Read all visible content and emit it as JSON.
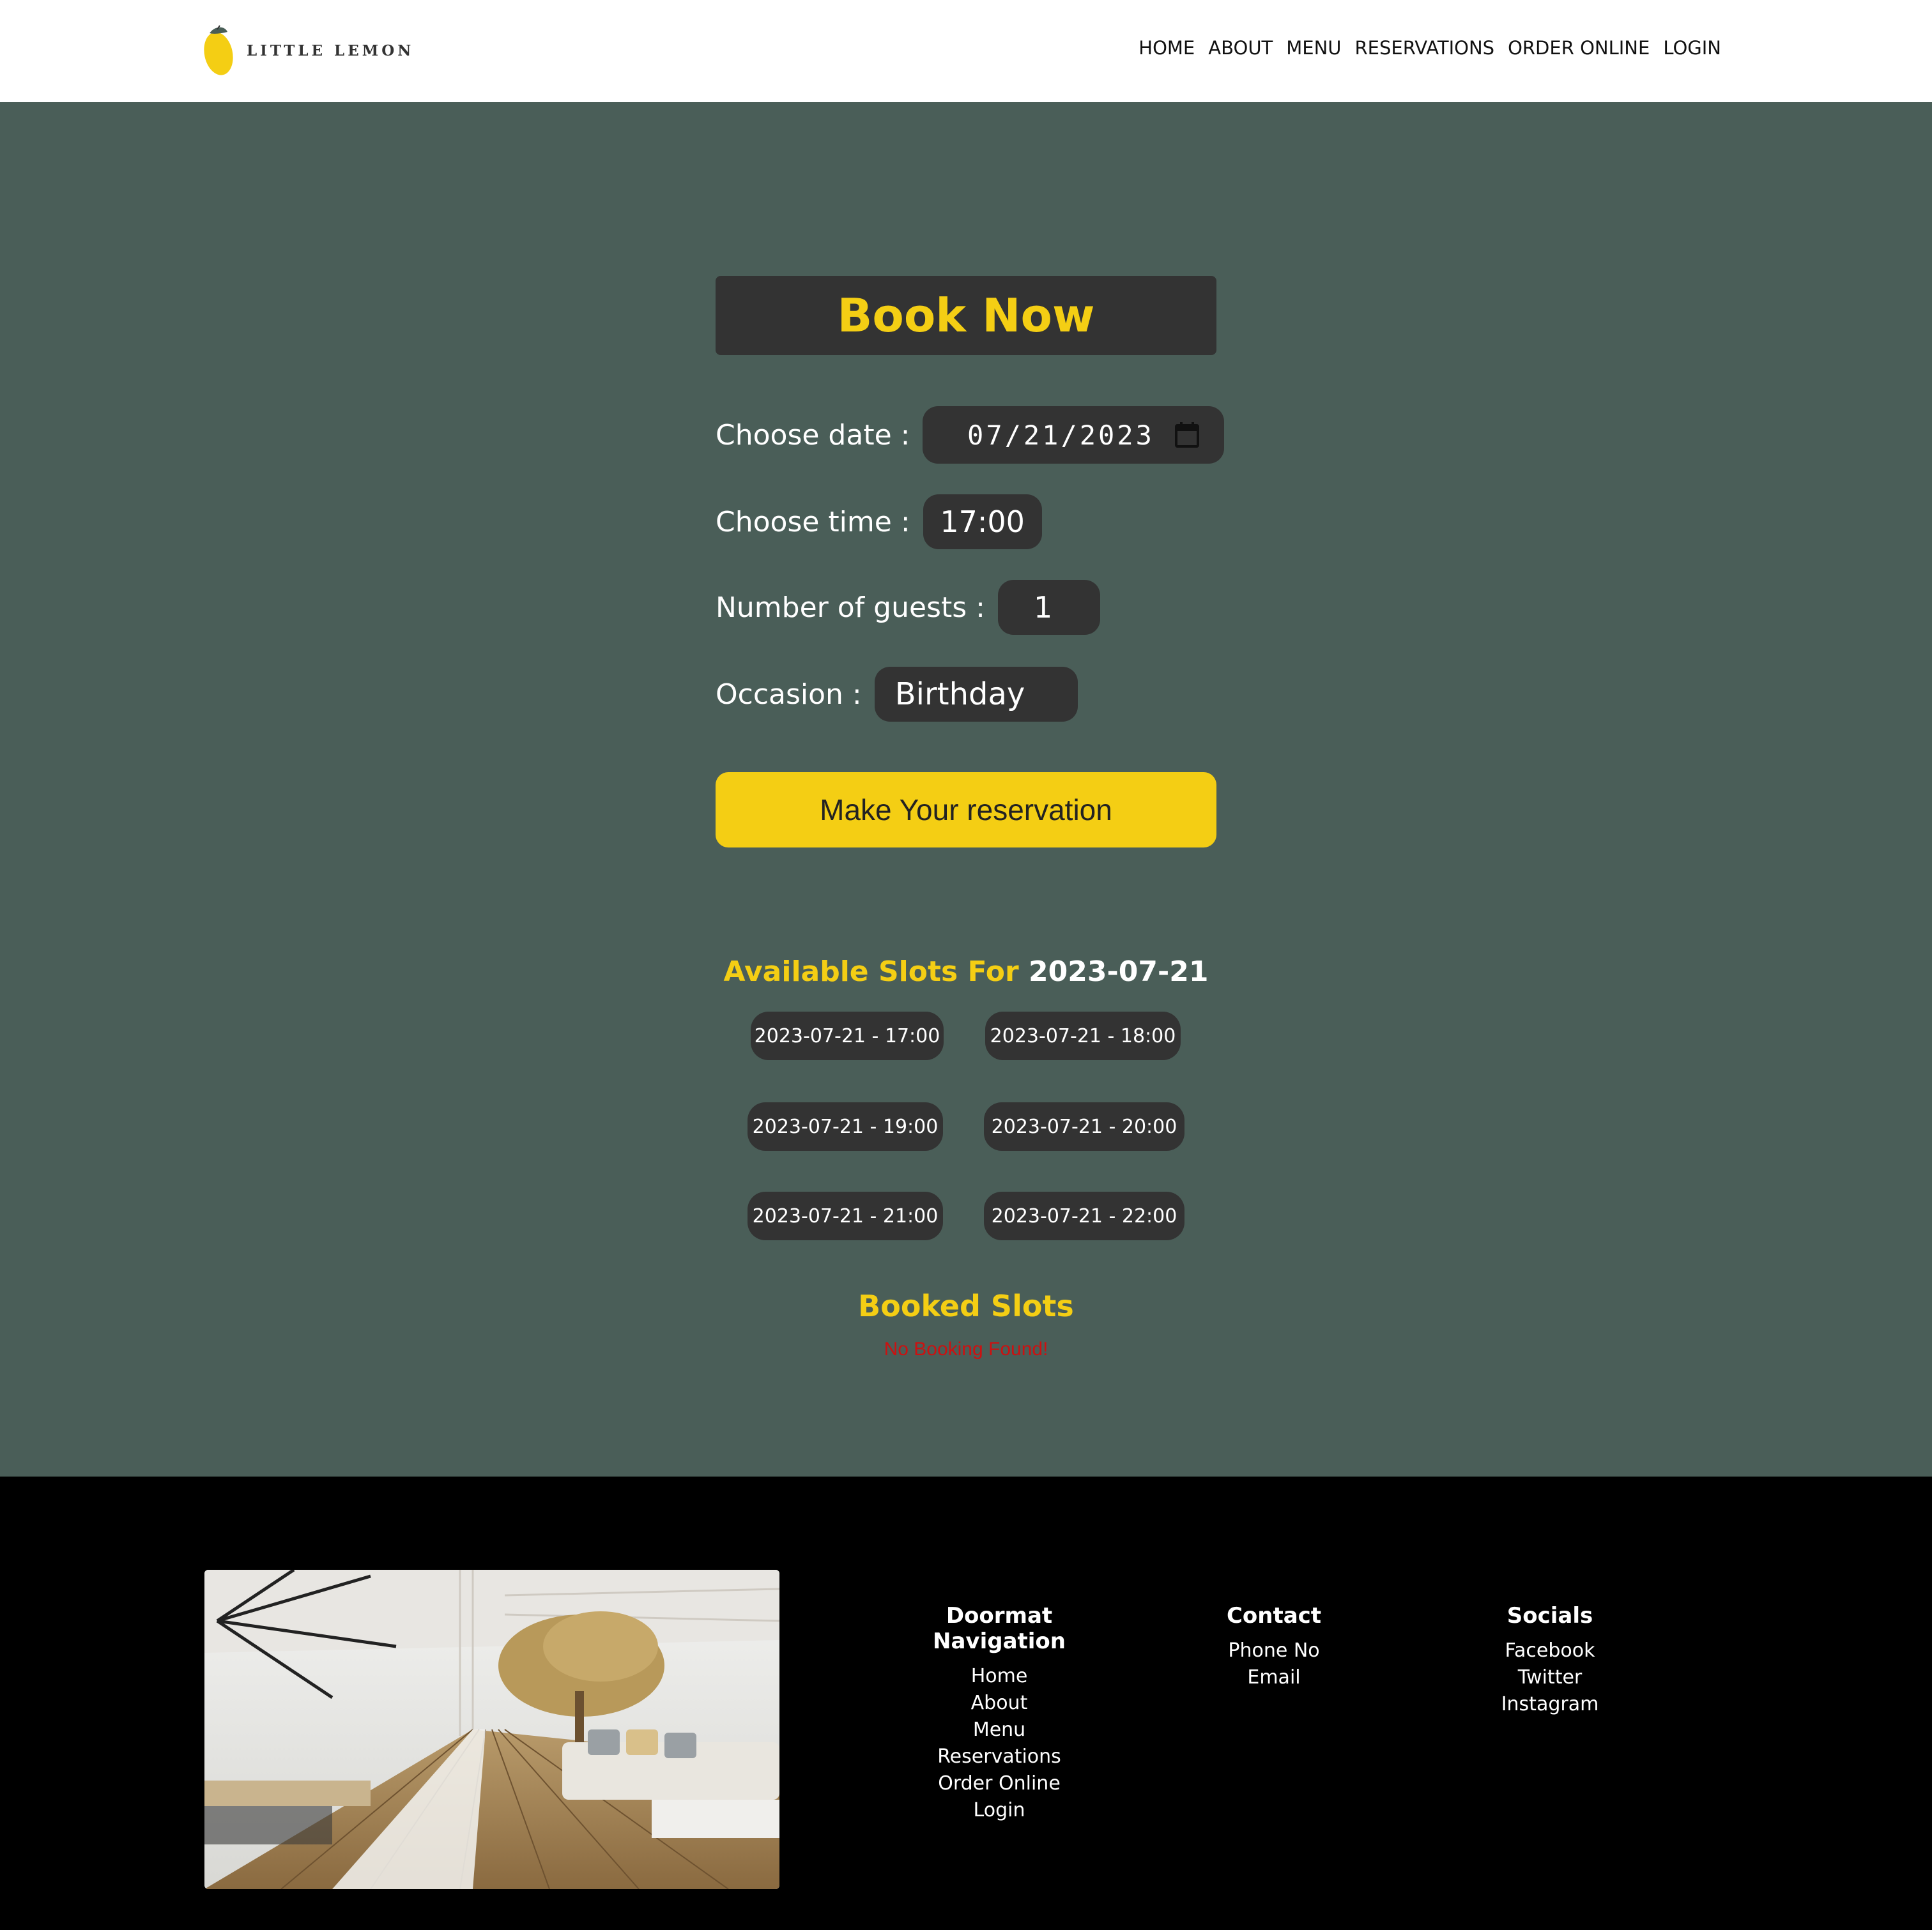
{
  "header": {
    "logo_text": "LITTLE LEMON",
    "nav": [
      "HOME",
      "ABOUT",
      "MENU",
      "RESERVATIONS",
      "ORDER ONLINE",
      "LOGIN"
    ]
  },
  "booking": {
    "title": "Book Now",
    "date_label": "Choose date :",
    "date_value": "07/21/2023",
    "time_label": "Choose time :",
    "time_value": "17:00",
    "guests_label": "Number of guests :",
    "guests_value": "1",
    "occasion_label": "Occasion :",
    "occasion_value": "Birthday",
    "submit_label": "Make Your reservation"
  },
  "slots": {
    "title_prefix": "Available Slots For",
    "title_date": "2023-07-21",
    "items": [
      "2023-07-21 - 17:00",
      "2023-07-21 - 18:00",
      "2023-07-21 - 19:00",
      "2023-07-21 - 20:00",
      "2023-07-21 - 21:00",
      "2023-07-21 - 22:00"
    ]
  },
  "booked": {
    "title": "Booked Slots",
    "empty_message": "No Booking Found!"
  },
  "footer": {
    "columns": [
      {
        "title": "Doormat Navigation",
        "items": [
          "Home",
          "About",
          "Menu",
          "Reservations",
          "Order Online",
          "Login"
        ]
      },
      {
        "title": "Contact",
        "items": [
          "Phone No",
          "Email"
        ]
      },
      {
        "title": "Socials",
        "items": [
          "Facebook",
          "Twitter",
          "Instagram"
        ]
      }
    ]
  },
  "colors": {
    "accent": "#f4ce14",
    "main_bg": "#4a5e58",
    "pill_bg": "#333333",
    "error": "#cc1111"
  },
  "icons": [
    "lemon-logo-icon",
    "calendar-icon"
  ]
}
